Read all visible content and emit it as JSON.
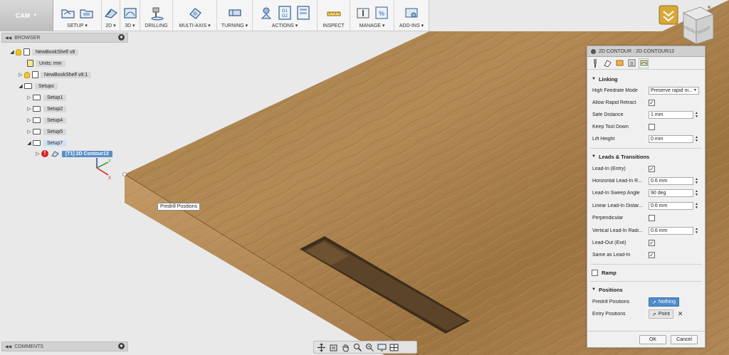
{
  "toolbar": {
    "workspace": "CAM",
    "groups": [
      {
        "id": "setup",
        "label": "SETUP ▾"
      },
      {
        "id": "2d",
        "label": "2D ▾"
      },
      {
        "id": "3d",
        "label": "3D ▾"
      },
      {
        "id": "drilling",
        "label": "DRILLING"
      },
      {
        "id": "multiaxis",
        "label": "MULTI-AXIS ▾"
      },
      {
        "id": "turning",
        "label": "TURNING ▾"
      },
      {
        "id": "actions",
        "label": "ACTIONS ▾"
      },
      {
        "id": "inspect",
        "label": "INSPECT"
      },
      {
        "id": "manage",
        "label": "MANAGE ▾"
      },
      {
        "id": "addins",
        "label": "ADD-INS ▾"
      }
    ],
    "gcode_icon_text": "G1 G2"
  },
  "browser": {
    "title": "BROWSER",
    "tree": [
      {
        "label": "NewBookShelf v8"
      },
      {
        "label": "Units: mm"
      },
      {
        "label": "NewBookShelf v8:1"
      },
      {
        "label": "Setups"
      },
      {
        "label": "Setup1"
      },
      {
        "label": "Setup2"
      },
      {
        "label": "Setup4"
      },
      {
        "label": "Setup5"
      },
      {
        "label": "Setup7"
      },
      {
        "label": "[T1] 2D Contour13"
      }
    ]
  },
  "comments": {
    "title": "COMMENTS"
  },
  "viewport": {
    "tooltip": "Predrill Positions"
  },
  "axes": {
    "x": "X",
    "y": "Y"
  },
  "viewcube": {
    "faces": [
      "FRONT",
      "RIGHT"
    ]
  },
  "dialog": {
    "title": "2D CONTOUR : 2D CONTOUR13",
    "sections": {
      "linking": "Linking",
      "leads": "Leads & Transitions",
      "ramp": "Ramp",
      "positions": "Positions"
    },
    "linking": {
      "high_feedrate_mode": {
        "label": "High Feedrate Mode",
        "value": "Preserve rapid m..."
      },
      "allow_rapid_retract": {
        "label": "Allow Rapid Retract",
        "checked": true
      },
      "safe_distance": {
        "label": "Safe Distance",
        "value": "1 mm"
      },
      "keep_tool_down": {
        "label": "Keep Tool Down",
        "checked": false
      },
      "lift_height": {
        "label": "Lift Height",
        "value": "0 mm"
      }
    },
    "leads": {
      "lead_in": {
        "label": "Lead-In (Entry)",
        "checked": true
      },
      "horizontal_radius": {
        "label": "Horizontal Lead-In R...",
        "value": "0.6 mm"
      },
      "sweep_angle": {
        "label": "Lead-In Sweep Angle",
        "value": "90 deg"
      },
      "linear_distance": {
        "label": "Linear Lead-In Distar...",
        "value": "0.6 mm"
      },
      "perpendicular": {
        "label": "Perpendicular",
        "checked": false
      },
      "vertical_radius": {
        "label": "Vertical Lead-In Radi...",
        "value": "0.6 mm"
      },
      "lead_out": {
        "label": "Lead-Out (Exit)",
        "checked": true
      },
      "same_as_lead_in": {
        "label": "Same as Lead-In",
        "checked": true
      }
    },
    "ramp": {
      "checked": false
    },
    "positions": {
      "predrill": {
        "label": "Predrill Positions",
        "value": "Nothing"
      },
      "entry": {
        "label": "Entry Positions",
        "value": "Point"
      }
    },
    "buttons": {
      "ok": "OK",
      "cancel": "Cancel"
    }
  }
}
